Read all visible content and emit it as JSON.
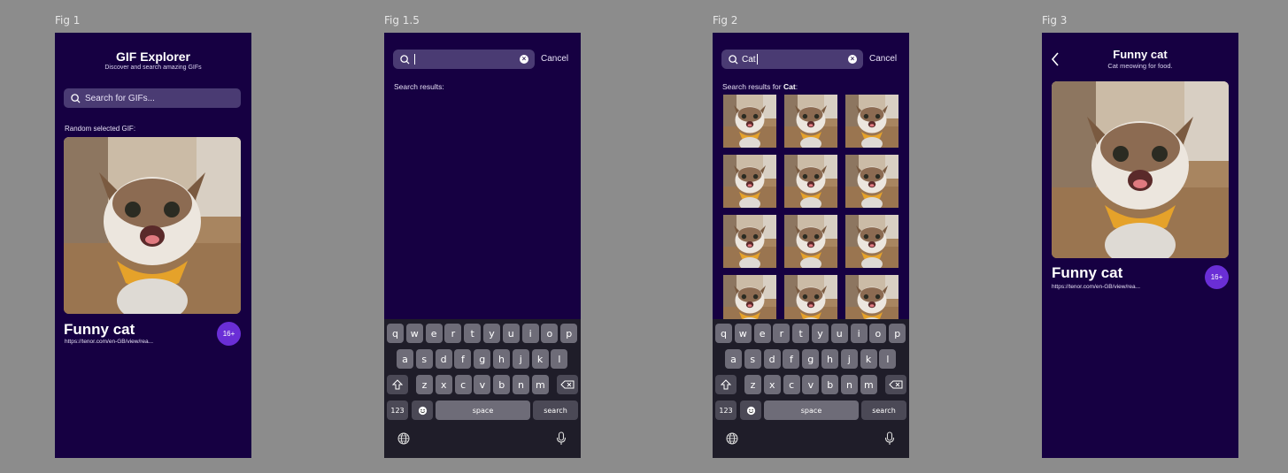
{
  "figures": {
    "fig1": "Fig 1",
    "fig1_5": "Fig 1.5",
    "fig2": "Fig 2",
    "fig3": "Fig 3"
  },
  "home": {
    "title": "GIF Explorer",
    "subtitle": "Discover and search amazing GIFs",
    "search_placeholder": "Search for GIFs...",
    "random_label": "Random selected GIF:",
    "gif_title": "Funny cat",
    "gif_url": "https://tenor.com/en-GB/view/rea...",
    "age_badge": "16+"
  },
  "search_empty": {
    "query": "",
    "cancel": "Cancel",
    "results_label": "Search results:"
  },
  "search_results": {
    "query": "Cat",
    "cancel": "Cancel",
    "results_prefix": "Search results for ",
    "results_term": "Cat",
    "results_suffix": ":"
  },
  "detail": {
    "title": "Funny cat",
    "subtitle": "Cat meowing for food.",
    "gif_title": "Funny cat",
    "gif_url": "https://tenor.com/en-GB/view/rea...",
    "age_badge": "16+"
  },
  "keyboard": {
    "row1": [
      "q",
      "w",
      "e",
      "r",
      "t",
      "y",
      "u",
      "i",
      "o",
      "p"
    ],
    "row2": [
      "a",
      "s",
      "d",
      "f",
      "g",
      "h",
      "j",
      "k",
      "l"
    ],
    "row3": [
      "z",
      "x",
      "c",
      "v",
      "b",
      "n",
      "m"
    ],
    "numbers_key": "123",
    "space_key": "space",
    "search_key": "search"
  },
  "colors": {
    "background": "#8c8c8c",
    "phone": "#160042",
    "search_field": "#4a3b73",
    "badge": "#6a2ed6",
    "keyboard": "#1f1d29",
    "key": "#6e6c78"
  }
}
